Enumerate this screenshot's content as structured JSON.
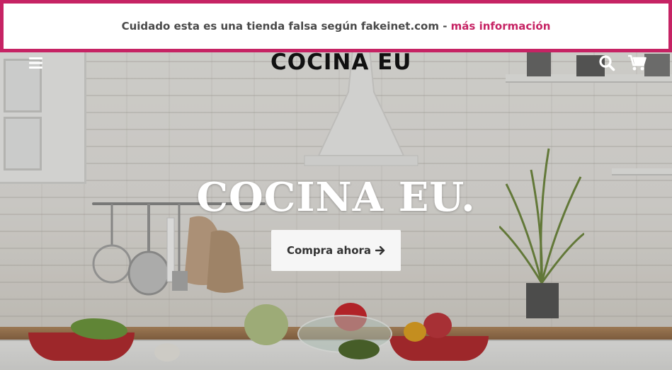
{
  "banner": {
    "text": "Cuidado esta es una tienda falsa según fakeinet.com - ",
    "link_text": "más información",
    "border_color": "#c62364"
  },
  "header": {
    "logo": "COCINA EU",
    "menu_icon": "hamburger-icon",
    "search_icon": "search-icon",
    "cart_icon": "cart-icon"
  },
  "hero": {
    "title": "COCINA EU.",
    "cta_label": "Compra ahora"
  }
}
